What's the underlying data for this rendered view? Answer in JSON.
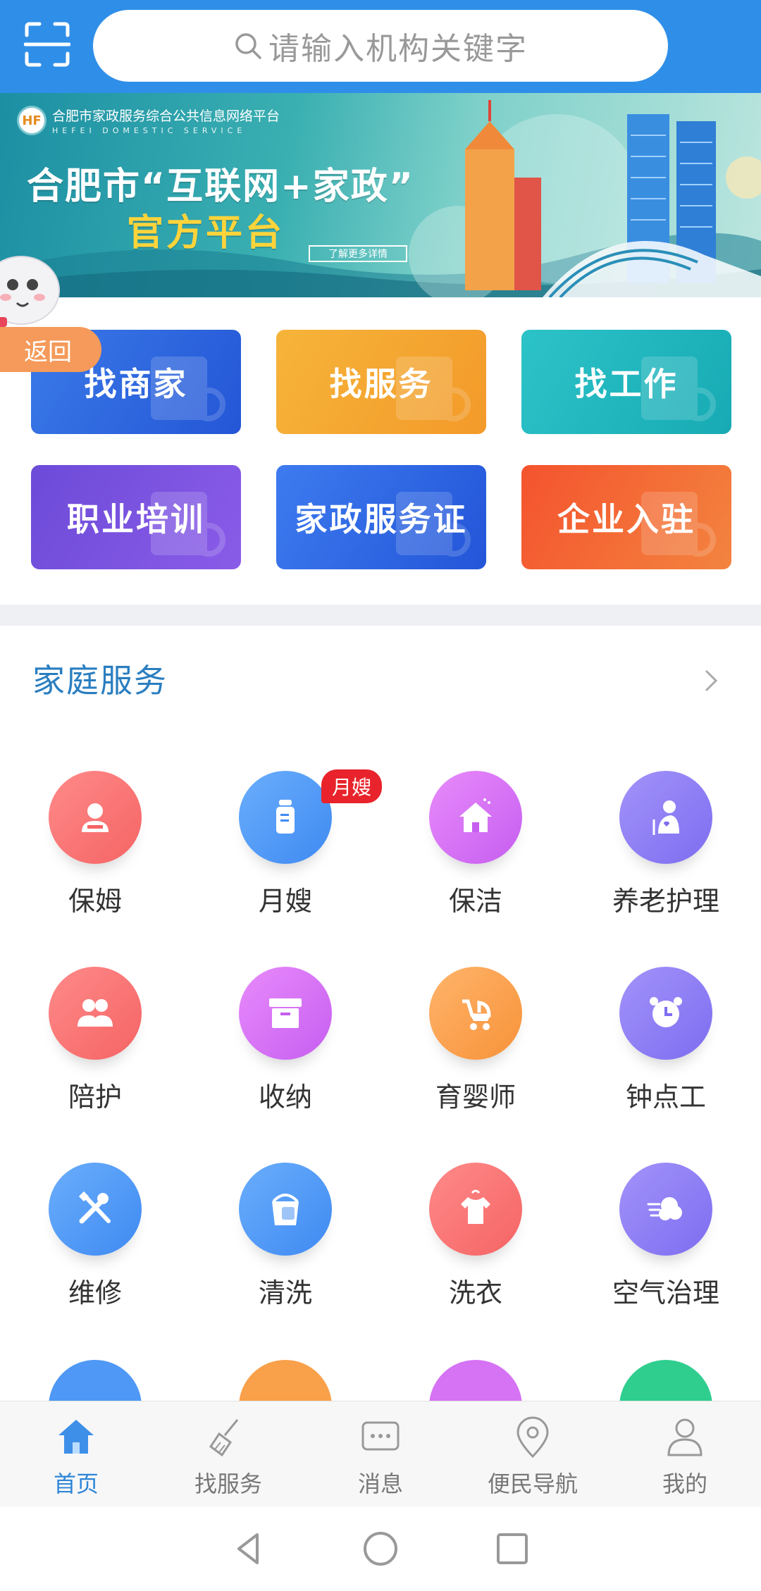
{
  "search": {
    "placeholder": "请输入机构关键字"
  },
  "banner": {
    "org_cn": "合肥市家政服务综合公共信息网络平台",
    "org_en": "HEFEI DOMESTIC SERVICE",
    "title": "合肥市“互联网+家政”",
    "subtitle": "官方平台",
    "more_label": "了解更多详情"
  },
  "back_label": "返回",
  "tiles": [
    {
      "label": "找商家",
      "color_from": "#3a7ae8",
      "color_to": "#2456d6"
    },
    {
      "label": "找服务",
      "color_from": "#f6b43a",
      "color_to": "#f39a2a"
    },
    {
      "label": "找工作",
      "color_from": "#2cc3c8",
      "color_to": "#17aab4"
    },
    {
      "label": "职业培训",
      "color_from": "#6c4bd8",
      "color_to": "#8a5ce8"
    },
    {
      "label": "家政服务证",
      "color_from": "#3d7bef",
      "color_to": "#2355d8"
    },
    {
      "label": "企业入驻",
      "color_from": "#f4532e",
      "color_to": "#f3843f"
    }
  ],
  "section": {
    "title": "家庭服务"
  },
  "badge_label": "月嫂",
  "services": [
    {
      "label": "保姆",
      "icon": "nanny-icon",
      "color_from": "#ff8a8a",
      "color_to": "#f56464"
    },
    {
      "label": "月嫂",
      "icon": "baby-bottle-icon",
      "color_from": "#6aaefc",
      "color_to": "#3f8af2"
    },
    {
      "label": "保洁",
      "icon": "house-clean-icon",
      "color_from": "#e88bfb",
      "color_to": "#c65ef0"
    },
    {
      "label": "养老护理",
      "icon": "elder-care-icon",
      "color_from": "#a293fa",
      "color_to": "#7e6df0"
    },
    {
      "label": "陪护",
      "icon": "people-icon",
      "color_from": "#ff8a8a",
      "color_to": "#f56464"
    },
    {
      "label": "收纳",
      "icon": "storage-box-icon",
      "color_from": "#e88bfb",
      "color_to": "#c65ef0"
    },
    {
      "label": "育婴师",
      "icon": "stroller-icon",
      "color_from": "#ffb46a",
      "color_to": "#f7923a"
    },
    {
      "label": "钟点工",
      "icon": "alarm-clock-icon",
      "color_from": "#a293fa",
      "color_to": "#7e6df0"
    },
    {
      "label": "维修",
      "icon": "tools-icon",
      "color_from": "#6aaefc",
      "color_to": "#3f8af2"
    },
    {
      "label": "清洗",
      "icon": "bucket-icon",
      "color_from": "#6aaefc",
      "color_to": "#3f8af2"
    },
    {
      "label": "洗衣",
      "icon": "shirt-icon",
      "color_from": "#ff8a8a",
      "color_to": "#f56464"
    },
    {
      "label": "空气治理",
      "icon": "air-icon",
      "color_from": "#a293fa",
      "color_to": "#7e6df0"
    }
  ],
  "partial_row_colors": [
    "#4f98f5",
    "#f9a04a",
    "#d672f4",
    "#2fce8e"
  ],
  "nav": [
    {
      "label": "首页",
      "icon": "home-icon",
      "active": true
    },
    {
      "label": "找服务",
      "icon": "broom-icon",
      "active": false
    },
    {
      "label": "消息",
      "icon": "message-icon",
      "active": false
    },
    {
      "label": "便民导航",
      "icon": "location-pin-icon",
      "active": false
    },
    {
      "label": "我的",
      "icon": "user-icon",
      "active": false
    }
  ]
}
